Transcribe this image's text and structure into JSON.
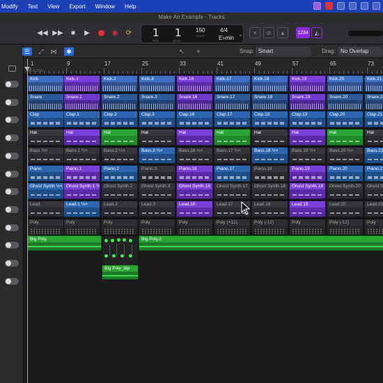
{
  "menubar": {
    "items": [
      "Modify",
      "Text",
      "View",
      "Export",
      "Window",
      "Help"
    ]
  },
  "window": {
    "title": "Make An Example - Tracks"
  },
  "lcd": {
    "bar": "1",
    "beat": "1",
    "bar_label": "BAR",
    "beat_label": "BEAT",
    "tempo": "150",
    "tempo_label": "KEEP",
    "signature": "4/4",
    "key": "E♭min"
  },
  "toolbar": {
    "count_in_badge": "1234",
    "snap_label": "Snap:",
    "snap_value": "Smart",
    "drag_label": "Drag:",
    "drag_value": "No Overlap"
  },
  "ruler": {
    "bars": [
      "1",
      "9",
      "17",
      "25",
      "33",
      "41",
      "49",
      "57",
      "65",
      "73"
    ],
    "cycle_text": "JAM 8 (3:3)"
  },
  "tracks": [
    {
      "name": "kick",
      "regions": [
        {
          "label": "Kick",
          "style": "kick",
          "content": "wave"
        },
        {
          "label": "Kick.1",
          "style": "kick p",
          "content": "wave"
        },
        {
          "label": "Kick.2",
          "style": "kick",
          "content": "wave"
        },
        {
          "label": "Kick.3",
          "style": "kick",
          "content": "wave"
        },
        {
          "label": "Kick.16",
          "style": "kick p",
          "content": "wave"
        },
        {
          "label": "Kick.17",
          "style": "kick",
          "content": "wave"
        },
        {
          "label": "Kick.18",
          "style": "kick",
          "content": "wave"
        },
        {
          "label": "Kick.19",
          "style": "kick p",
          "content": "wave"
        },
        {
          "label": "Kick.20",
          "style": "kick",
          "content": "wave"
        },
        {
          "label": "Kick.21",
          "style": "kick",
          "content": "wave"
        }
      ]
    },
    {
      "name": "snare",
      "regions": [
        {
          "label": "Snare",
          "style": "snare",
          "content": "wave"
        },
        {
          "label": "Snare.1",
          "style": "snare p",
          "content": "wave"
        },
        {
          "label": "Snare.2",
          "style": "snare",
          "content": "wave"
        },
        {
          "label": "Snare.3",
          "style": "snare",
          "content": "wave"
        },
        {
          "label": "Snare.16",
          "style": "snare p",
          "content": "wave"
        },
        {
          "label": "Snare.17",
          "style": "snare",
          "content": "wave"
        },
        {
          "label": "Snare.18",
          "style": "snare",
          "content": "wave"
        },
        {
          "label": "Snare.19",
          "style": "snare p",
          "content": "wave"
        },
        {
          "label": "Snare.20",
          "style": "snare",
          "content": "wave"
        },
        {
          "label": "Snare.21",
          "style": "snare",
          "content": "wave"
        }
      ]
    },
    {
      "name": "clap",
      "regions": [
        {
          "label": "Clap",
          "style": "clap",
          "content": "midi"
        },
        {
          "label": "Clap.1",
          "style": "clap",
          "content": "midi"
        },
        {
          "label": "Clap.2",
          "style": "clap",
          "content": "midi"
        },
        {
          "label": "Clap.3",
          "style": "clap",
          "content": "midi"
        },
        {
          "label": "Clap.16",
          "style": "clap",
          "content": "midi"
        },
        {
          "label": "Clap.17",
          "style": "clap",
          "content": "midi"
        },
        {
          "label": "Clap.18",
          "style": "clap",
          "content": "midi"
        },
        {
          "label": "Clap.19",
          "style": "clap",
          "content": "midi"
        },
        {
          "label": "Clap.20",
          "style": "clap",
          "content": "midi"
        },
        {
          "label": "Clap.21",
          "style": "clap",
          "content": "midi"
        }
      ]
    },
    {
      "name": "hat",
      "regions": [
        {
          "label": "Hat",
          "style": "hat",
          "content": "midi thin"
        },
        {
          "label": "Hat",
          "style": "hat p",
          "content": "midi thin"
        },
        {
          "label": "Hat",
          "style": "hat g",
          "content": "midi thin"
        },
        {
          "label": "Hat",
          "style": "hat",
          "content": "midi thin"
        },
        {
          "label": "Hat",
          "style": "hat p",
          "content": "midi thin"
        },
        {
          "label": "Hat",
          "style": "hat g",
          "content": "midi thin"
        },
        {
          "label": "Hat",
          "style": "hat",
          "content": "midi thin"
        },
        {
          "label": "Hat",
          "style": "hat p",
          "content": "midi thin"
        },
        {
          "label": "Hat",
          "style": "hat g",
          "content": "midi thin"
        },
        {
          "label": "Hat",
          "style": "hat",
          "content": "midi thin"
        }
      ]
    },
    {
      "name": "bass",
      "regions": [
        {
          "label": "Bass ½×",
          "style": "bass",
          "content": "midi thin"
        },
        {
          "label": "Bass.1 ½×",
          "style": "bass",
          "content": "midi thin"
        },
        {
          "label": "Bass.2 ½×",
          "style": "bass",
          "content": "midi thin"
        },
        {
          "label": "Bass.3 ½×",
          "style": "bass b",
          "content": "midi thin"
        },
        {
          "label": "Bass.16 ½×",
          "style": "bass",
          "content": "midi thin"
        },
        {
          "label": "Bass.17 ½×",
          "style": "bass",
          "content": "midi thin"
        },
        {
          "label": "Bass.18 ½×",
          "style": "bass b",
          "content": "midi thin"
        },
        {
          "label": "Bass.19 ½×",
          "style": "bass",
          "content": "midi thin"
        },
        {
          "label": "Bass.20 ½×",
          "style": "bass",
          "content": "midi thin"
        },
        {
          "label": "Bass.21",
          "style": "bass b",
          "content": "midi thin"
        }
      ]
    },
    {
      "name": "piano",
      "regions": [
        {
          "label": "Piano",
          "style": "piano",
          "content": "midi"
        },
        {
          "label": "Piano.1",
          "style": "piano p",
          "content": "midi"
        },
        {
          "label": "Piano.2",
          "style": "piano",
          "content": "midi"
        },
        {
          "label": "Piano.3",
          "style": "piano d",
          "content": "midi"
        },
        {
          "label": "Piano.16",
          "style": "piano p",
          "content": "midi"
        },
        {
          "label": "Piano.17",
          "style": "piano",
          "content": "midi"
        },
        {
          "label": "Piano.18",
          "style": "piano d",
          "content": "midi"
        },
        {
          "label": "Piano.19",
          "style": "piano p",
          "content": "midi"
        },
        {
          "label": "Piano.20",
          "style": "piano",
          "content": "midi"
        },
        {
          "label": "Piano.21",
          "style": "piano",
          "content": "midi"
        }
      ]
    },
    {
      "name": "ghost-synth",
      "regions": [
        {
          "label": "Ghost Synth ½×",
          "style": "ghost",
          "content": "midi thin"
        },
        {
          "label": "Ghost Synth.1 ½×",
          "style": "ghost p",
          "content": "midi thin"
        },
        {
          "label": "Ghost Synth.2",
          "style": "ghost d",
          "content": "midi thin"
        },
        {
          "label": "Ghost Synth.3",
          "style": "ghost d",
          "content": "midi thin"
        },
        {
          "label": "Ghost Synth.16",
          "style": "ghost p",
          "content": "midi thin"
        },
        {
          "label": "Ghost Synth.17",
          "style": "ghost d",
          "content": "midi thin"
        },
        {
          "label": "Ghost Synth.18",
          "style": "ghost d",
          "content": "midi thin"
        },
        {
          "label": "Ghost Synth.19",
          "style": "ghost p",
          "content": "midi thin"
        },
        {
          "label": "Ghost Synth.20",
          "style": "ghost d",
          "content": "midi thin"
        },
        {
          "label": "Ghost Synth.21",
          "style": "ghost d",
          "content": "midi thin"
        }
      ]
    },
    {
      "name": "lead",
      "regions": [
        {
          "label": "Lead",
          "style": "lead",
          "content": "midi thin"
        },
        {
          "label": "Lead.1 ½×",
          "style": "lead b",
          "content": "midi thin"
        },
        {
          "label": "Lead.2",
          "style": "lead",
          "content": "midi thin"
        },
        {
          "label": "Lead.3",
          "style": "lead",
          "content": "midi thin"
        },
        {
          "label": "Lead.16",
          "style": "lead p",
          "content": "midi thin"
        },
        {
          "label": "Lead.17",
          "style": "lead",
          "content": "midi thin"
        },
        {
          "label": "Lead.18",
          "style": "lead",
          "content": "midi thin"
        },
        {
          "label": "Lead.19",
          "style": "lead p",
          "content": "midi thin"
        },
        {
          "label": "Lead.20",
          "style": "lead",
          "content": "midi thin"
        },
        {
          "label": "Lead.21",
          "style": "lead",
          "content": "midi thin"
        }
      ]
    },
    {
      "name": "poly",
      "regions": [
        {
          "label": "Poly",
          "style": "poly",
          "content": "dots"
        },
        {
          "label": "Poly",
          "style": "poly",
          "content": "dots"
        },
        {
          "label": "Poly",
          "style": "poly",
          "content": "dots"
        },
        {
          "label": "Poly",
          "style": "poly",
          "content": "dots"
        },
        {
          "label": "Poly",
          "style": "poly",
          "content": "dots"
        },
        {
          "label": "Poly (+12)",
          "style": "poly",
          "content": "dots"
        },
        {
          "label": "Poly (-12)",
          "style": "poly",
          "content": "dots"
        },
        {
          "label": "Poly",
          "style": "poly",
          "content": "dots"
        },
        {
          "label": "Poly (-12)",
          "style": "poly",
          "content": "dots"
        },
        {
          "label": "Poly",
          "style": "poly",
          "content": "dots"
        }
      ]
    }
  ],
  "big_poly": {
    "region1": "Big Poly",
    "region2": "Big Poly.2",
    "bip": "Big Poly_bip"
  }
}
